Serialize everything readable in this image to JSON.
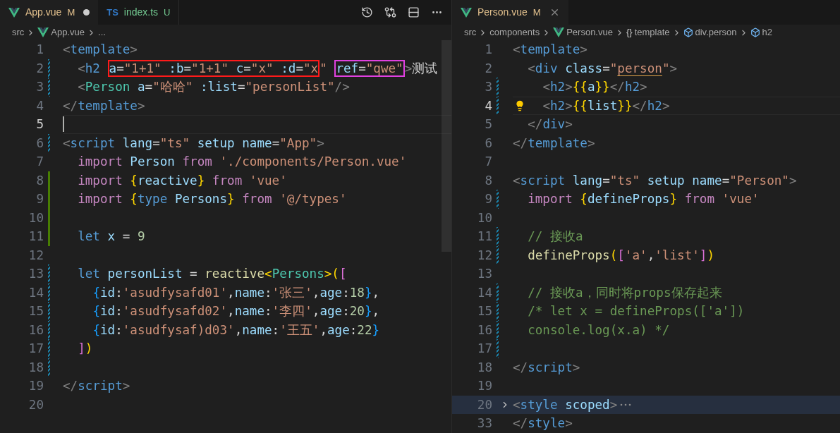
{
  "left_editor": {
    "tabs": [
      {
        "kind": "vue",
        "label": "App.vue",
        "badge": "M",
        "untracked": false,
        "selected": true,
        "dirty": true
      },
      {
        "kind": "ts",
        "icon_text": "TS",
        "label": "index.ts",
        "badge": "U",
        "untracked": true,
        "selected": false,
        "dirty": false
      }
    ],
    "breadcrumbs": [
      {
        "kind": "folder",
        "label": "src"
      },
      {
        "kind": "vue",
        "label": "App.vue"
      },
      {
        "kind": "more",
        "label": "..."
      }
    ],
    "lines": [
      {
        "number": "1",
        "kind": "unchanged",
        "tokens": [
          {
            "kind": "punct",
            "text": "<"
          },
          {
            "kind": "tag",
            "text": "template"
          },
          {
            "kind": "punct",
            "text": ">"
          }
        ]
      },
      {
        "number": "2",
        "kind": "modified",
        "tokens": [
          {
            "kind": "punct",
            "text": "  <"
          },
          {
            "kind": "tag",
            "text": "h2 "
          },
          {
            "kind": "box",
            "color": "#ff1a1a",
            "tokens": [
              {
                "kind": "attr",
                "text": "a"
              },
              {
                "kind": "text",
                "text": "="
              },
              {
                "kind": "string",
                "text": "\"1+1\""
              },
              {
                "kind": "attr",
                "text": " :b"
              },
              {
                "kind": "text",
                "text": "="
              },
              {
                "kind": "string",
                "text": "\"1+1\""
              },
              {
                "kind": "attr",
                "text": " c"
              },
              {
                "kind": "text",
                "text": "="
              },
              {
                "kind": "string",
                "text": "\"x\""
              },
              {
                "kind": "attr",
                "text": " :d"
              },
              {
                "kind": "text",
                "text": "="
              },
              {
                "kind": "string",
                "text": "\"x"
              }
            ]
          },
          {
            "kind": "string",
            "text": "\" "
          },
          {
            "kind": "box",
            "color": "#e040e0",
            "tokens": [
              {
                "kind": "attr",
                "text": "ref"
              },
              {
                "kind": "text",
                "text": "="
              },
              {
                "kind": "string",
                "text": "\"qwe\""
              }
            ]
          },
          {
            "kind": "punct",
            "text": ">"
          },
          {
            "kind": "text",
            "text": "测试"
          }
        ]
      },
      {
        "number": "3",
        "kind": "modified",
        "tokens": [
          {
            "kind": "punct",
            "text": "  <"
          },
          {
            "kind": "component",
            "text": "Person"
          },
          {
            "kind": "attr",
            "text": " a"
          },
          {
            "kind": "text",
            "text": "="
          },
          {
            "kind": "string",
            "text": "\"哈哈\""
          },
          {
            "kind": "attr",
            "text": " :list"
          },
          {
            "kind": "text",
            "text": "="
          },
          {
            "kind": "string",
            "text": "\"personList\""
          },
          {
            "kind": "punct",
            "text": "/>"
          }
        ]
      },
      {
        "number": "4",
        "kind": "unchanged",
        "tokens": [
          {
            "kind": "punct",
            "text": "</"
          },
          {
            "kind": "tag",
            "text": "template"
          },
          {
            "kind": "punct",
            "text": ">"
          }
        ]
      },
      {
        "number": "5",
        "kind": "unchanged",
        "current": true
      },
      {
        "number": "6",
        "kind": "modified",
        "tokens": [
          {
            "kind": "punct",
            "text": "<"
          },
          {
            "kind": "tag",
            "text": "script"
          },
          {
            "kind": "attr",
            "text": " lang"
          },
          {
            "kind": "text",
            "text": "="
          },
          {
            "kind": "string",
            "text": "\"ts\""
          },
          {
            "kind": "attr",
            "text": " setup"
          },
          {
            "kind": "attr",
            "text": " name"
          },
          {
            "kind": "text",
            "text": "="
          },
          {
            "kind": "string",
            "text": "\"App\""
          },
          {
            "kind": "punct",
            "text": ">"
          }
        ]
      },
      {
        "number": "7",
        "kind": "unchanged",
        "tokens": [
          {
            "kind": "keyword",
            "text": "  import"
          },
          {
            "kind": "var",
            "text": " Person"
          },
          {
            "kind": "keyword",
            "text": " from"
          },
          {
            "kind": "string",
            "text": " './components/Person.vue'"
          }
        ]
      },
      {
        "number": "8",
        "kind": "added",
        "tokens": [
          {
            "kind": "keyword",
            "text": "  import"
          },
          {
            "kind": "bracket1",
            "text": " {"
          },
          {
            "kind": "var",
            "text": "reactive"
          },
          {
            "kind": "bracket1",
            "text": "}"
          },
          {
            "kind": "keyword",
            "text": " from"
          },
          {
            "kind": "string",
            "text": " 'vue'"
          }
        ]
      },
      {
        "number": "9",
        "kind": "added",
        "tokens": [
          {
            "kind": "keyword",
            "text": "  import"
          },
          {
            "kind": "bracket1",
            "text": " {"
          },
          {
            "kind": "storage",
            "text": "type"
          },
          {
            "kind": "var",
            "text": " Persons"
          },
          {
            "kind": "bracket1",
            "text": "}"
          },
          {
            "kind": "keyword",
            "text": " from"
          },
          {
            "kind": "string",
            "text": " '@/types'"
          }
        ]
      },
      {
        "number": "10",
        "kind": "added"
      },
      {
        "number": "11",
        "kind": "added",
        "tokens": [
          {
            "kind": "storage",
            "text": "  let"
          },
          {
            "kind": "var",
            "text": " x"
          },
          {
            "kind": "text",
            "text": " ="
          },
          {
            "kind": "number",
            "text": " 9"
          }
        ]
      },
      {
        "number": "12",
        "kind": "unchanged"
      },
      {
        "number": "13",
        "kind": "modified",
        "tokens": [
          {
            "kind": "storage",
            "text": "  let"
          },
          {
            "kind": "var",
            "text": " personList"
          },
          {
            "kind": "text",
            "text": " ="
          },
          {
            "kind": "func",
            "text": " reactive"
          },
          {
            "kind": "bracket1",
            "text": "<"
          },
          {
            "kind": "type",
            "text": "Persons"
          },
          {
            "kind": "bracket1",
            "text": ">("
          },
          {
            "kind": "bracket2",
            "text": "["
          }
        ]
      },
      {
        "number": "14",
        "kind": "modified",
        "tokens": [
          {
            "kind": "bracket3",
            "text": "    {"
          },
          {
            "kind": "var",
            "text": "id"
          },
          {
            "kind": "text",
            "text": ":"
          },
          {
            "kind": "string",
            "text": "'asudfysafd01'"
          },
          {
            "kind": "text",
            "text": ","
          },
          {
            "kind": "var",
            "text": "name"
          },
          {
            "kind": "text",
            "text": ":"
          },
          {
            "kind": "string",
            "text": "'张三'"
          },
          {
            "kind": "text",
            "text": ","
          },
          {
            "kind": "var",
            "text": "age"
          },
          {
            "kind": "text",
            "text": ":"
          },
          {
            "kind": "number",
            "text": "18"
          },
          {
            "kind": "bracket3",
            "text": "}"
          },
          {
            "kind": "text",
            "text": ","
          }
        ]
      },
      {
        "number": "15",
        "kind": "modified",
        "tokens": [
          {
            "kind": "bracket3",
            "text": "    {"
          },
          {
            "kind": "var",
            "text": "id"
          },
          {
            "kind": "text",
            "text": ":"
          },
          {
            "kind": "string",
            "text": "'asudfysafd02'"
          },
          {
            "kind": "text",
            "text": ","
          },
          {
            "kind": "var",
            "text": "name"
          },
          {
            "kind": "text",
            "text": ":"
          },
          {
            "kind": "string",
            "text": "'李四'"
          },
          {
            "kind": "text",
            "text": ","
          },
          {
            "kind": "var",
            "text": "age"
          },
          {
            "kind": "text",
            "text": ":"
          },
          {
            "kind": "number",
            "text": "20"
          },
          {
            "kind": "bracket3",
            "text": "}"
          },
          {
            "kind": "text",
            "text": ","
          }
        ]
      },
      {
        "number": "16",
        "kind": "modified",
        "tokens": [
          {
            "kind": "bracket3",
            "text": "    {"
          },
          {
            "kind": "var",
            "text": "id"
          },
          {
            "kind": "text",
            "text": ":"
          },
          {
            "kind": "string",
            "text": "'asudfysaf)d03'"
          },
          {
            "kind": "text",
            "text": ","
          },
          {
            "kind": "var",
            "text": "name"
          },
          {
            "kind": "text",
            "text": ":"
          },
          {
            "kind": "string",
            "text": "'王五'"
          },
          {
            "kind": "text",
            "text": ","
          },
          {
            "kind": "var",
            "text": "age"
          },
          {
            "kind": "text",
            "text": ":"
          },
          {
            "kind": "number",
            "text": "22"
          },
          {
            "kind": "bracket3",
            "text": "}"
          }
        ]
      },
      {
        "number": "17",
        "kind": "modified",
        "tokens": [
          {
            "kind": "bracket2",
            "text": "  ]"
          },
          {
            "kind": "bracket1",
            "text": ")"
          }
        ]
      },
      {
        "number": "18",
        "kind": "modified"
      },
      {
        "number": "19",
        "kind": "unchanged",
        "tokens": [
          {
            "kind": "punct",
            "text": "</"
          },
          {
            "kind": "tag",
            "text": "script"
          },
          {
            "kind": "punct",
            "text": ">"
          }
        ]
      },
      {
        "number": "20",
        "kind": "unchanged"
      }
    ]
  },
  "right_editor": {
    "tabs": [
      {
        "kind": "vue",
        "label": "Person.vue",
        "badge": "M",
        "untracked": false,
        "selected": true,
        "dirty": false
      }
    ],
    "breadcrumbs": [
      {
        "kind": "folder",
        "label": "src"
      },
      {
        "kind": "folder",
        "label": "components"
      },
      {
        "kind": "vue",
        "label": "Person.vue"
      },
      {
        "kind": "braces",
        "icon_text": "{}",
        "label": "template"
      },
      {
        "kind": "element",
        "label": "div.person"
      },
      {
        "kind": "element",
        "label": "h2"
      }
    ],
    "lines": [
      {
        "number": "1",
        "kind": "unchanged",
        "tokens": [
          {
            "kind": "punct",
            "text": "<"
          },
          {
            "kind": "tag",
            "text": "template"
          },
          {
            "kind": "punct",
            "text": ">"
          }
        ]
      },
      {
        "number": "2",
        "kind": "unchanged",
        "tokens": [
          {
            "kind": "punct",
            "text": "  <"
          },
          {
            "kind": "tag",
            "text": "div"
          },
          {
            "kind": "attr",
            "text": " class"
          },
          {
            "kind": "text",
            "text": "="
          },
          {
            "kind": "string",
            "text": "\""
          },
          {
            "kind": "warning_string",
            "text": "person"
          },
          {
            "kind": "string",
            "text": "\""
          },
          {
            "kind": "punct",
            "text": ">"
          }
        ]
      },
      {
        "number": "3",
        "kind": "modified",
        "tokens": [
          {
            "kind": "punct",
            "text": "    <"
          },
          {
            "kind": "tag",
            "text": "h2"
          },
          {
            "kind": "punct",
            "text": ">"
          },
          {
            "kind": "bracket1",
            "text": "{{"
          },
          {
            "kind": "var",
            "text": "a"
          },
          {
            "kind": "bracket1",
            "text": "}}"
          },
          {
            "kind": "punct",
            "text": "</"
          },
          {
            "kind": "tag",
            "text": "h2"
          },
          {
            "kind": "punct",
            "text": ">"
          }
        ]
      },
      {
        "number": "4",
        "kind": "modified",
        "current": true,
        "lightbulb": true,
        "tokens": [
          {
            "kind": "punct",
            "text": "    <"
          },
          {
            "kind": "tag",
            "text": "h2"
          },
          {
            "kind": "punct",
            "text": ">"
          },
          {
            "kind": "bracket1",
            "text": "{{"
          },
          {
            "kind": "var",
            "text": "list"
          },
          {
            "kind": "bracket1",
            "text": "}}"
          },
          {
            "kind": "punct",
            "text": "</"
          },
          {
            "kind": "tag",
            "text": "h2"
          },
          {
            "kind": "punct",
            "text": ">"
          }
        ]
      },
      {
        "number": "5",
        "kind": "unchanged",
        "tokens": [
          {
            "kind": "punct",
            "text": "  </"
          },
          {
            "kind": "tag",
            "text": "div"
          },
          {
            "kind": "punct",
            "text": ">"
          }
        ]
      },
      {
        "number": "6",
        "kind": "unchanged",
        "tokens": [
          {
            "kind": "punct",
            "text": "</"
          },
          {
            "kind": "tag",
            "text": "template"
          },
          {
            "kind": "punct",
            "text": ">"
          }
        ]
      },
      {
        "number": "7",
        "kind": "unchanged"
      },
      {
        "number": "8",
        "kind": "unchanged",
        "tokens": [
          {
            "kind": "punct",
            "text": "<"
          },
          {
            "kind": "tag",
            "text": "script"
          },
          {
            "kind": "attr",
            "text": " lang"
          },
          {
            "kind": "text",
            "text": "="
          },
          {
            "kind": "string",
            "text": "\"ts\""
          },
          {
            "kind": "attr",
            "text": " setup"
          },
          {
            "kind": "attr",
            "text": " name"
          },
          {
            "kind": "text",
            "text": "="
          },
          {
            "kind": "string",
            "text": "\"Person\""
          },
          {
            "kind": "punct",
            "text": ">"
          }
        ]
      },
      {
        "number": "9",
        "kind": "modified",
        "tokens": [
          {
            "kind": "keyword",
            "text": "  import"
          },
          {
            "kind": "bracket1",
            "text": " {"
          },
          {
            "kind": "var",
            "text": "defineProps"
          },
          {
            "kind": "bracket1",
            "text": "}"
          },
          {
            "kind": "keyword",
            "text": " from"
          },
          {
            "kind": "string",
            "text": " 'vue'"
          }
        ]
      },
      {
        "number": "10",
        "kind": "unchanged"
      },
      {
        "number": "11",
        "kind": "modified",
        "tokens": [
          {
            "kind": "comment",
            "text": "  // 接收a"
          }
        ]
      },
      {
        "number": "12",
        "kind": "modified",
        "tokens": [
          {
            "kind": "func",
            "text": "  defineProps"
          },
          {
            "kind": "bracket1",
            "text": "("
          },
          {
            "kind": "bracket2",
            "text": "["
          },
          {
            "kind": "string",
            "text": "'a'"
          },
          {
            "kind": "text",
            "text": ","
          },
          {
            "kind": "string",
            "text": "'list'"
          },
          {
            "kind": "bracket2",
            "text": "]"
          },
          {
            "kind": "bracket1",
            "text": ")"
          }
        ]
      },
      {
        "number": "13",
        "kind": "unchanged"
      },
      {
        "number": "14",
        "kind": "modified",
        "tokens": [
          {
            "kind": "comment",
            "text": "  // 接收a，同时将props保存起来"
          }
        ]
      },
      {
        "number": "15",
        "kind": "modified",
        "tokens": [
          {
            "kind": "comment",
            "text": "  /* let x = defineProps(['a'])"
          }
        ]
      },
      {
        "number": "16",
        "kind": "modified",
        "tokens": [
          {
            "kind": "comment",
            "text": "  console.log(x.a) */"
          }
        ]
      },
      {
        "number": "17",
        "kind": "modified"
      },
      {
        "number": "18",
        "kind": "unchanged",
        "tokens": [
          {
            "kind": "punct",
            "text": "</"
          },
          {
            "kind": "tag",
            "text": "script"
          },
          {
            "kind": "punct",
            "text": ">"
          }
        ]
      },
      {
        "number": "19",
        "kind": "unchanged"
      },
      {
        "number": "20",
        "kind": "unchanged",
        "folded": true,
        "tokens": [
          {
            "kind": "punct",
            "text": "<"
          },
          {
            "kind": "tag",
            "text": "style"
          },
          {
            "kind": "attr",
            "text": " scoped"
          },
          {
            "kind": "punct",
            "text": ">"
          }
        ]
      },
      {
        "number": "33",
        "kind": "unchanged",
        "tokens": [
          {
            "kind": "punct",
            "text": "</"
          },
          {
            "kind": "tag",
            "text": "style"
          },
          {
            "kind": "punct",
            "text": ">"
          }
        ]
      }
    ]
  }
}
